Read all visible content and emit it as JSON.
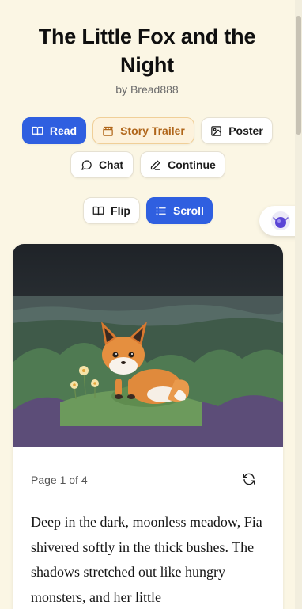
{
  "story": {
    "title": "The Little Fox and the Night",
    "byline": "by Bread888"
  },
  "actions": {
    "read": "Read",
    "trailer": "Story Trailer",
    "poster": "Poster",
    "chat": "Chat",
    "continue": "Continue"
  },
  "view_modes": {
    "flip": "Flip",
    "scroll": "Scroll"
  },
  "reader": {
    "page_label": "Page 1 of 4",
    "text": "Deep in the dark, moonless meadow, Fia shivered softly in the thick bushes. The shadows stretched out like hungry monsters, and her little"
  },
  "colors": {
    "background": "#fbf6e4",
    "primary": "#2f5fe0",
    "trailer_bg": "#fdf2dc",
    "trailer_text": "#b0661a"
  },
  "icons": {
    "read": "book-open-icon",
    "trailer": "clapperboard-icon",
    "poster": "image-icon",
    "chat": "chat-bubble-icon",
    "continue": "pencil-icon",
    "flip": "book-open-icon",
    "scroll": "list-icon",
    "refresh": "refresh-icon",
    "assistant": "assistant-orb-icon"
  }
}
